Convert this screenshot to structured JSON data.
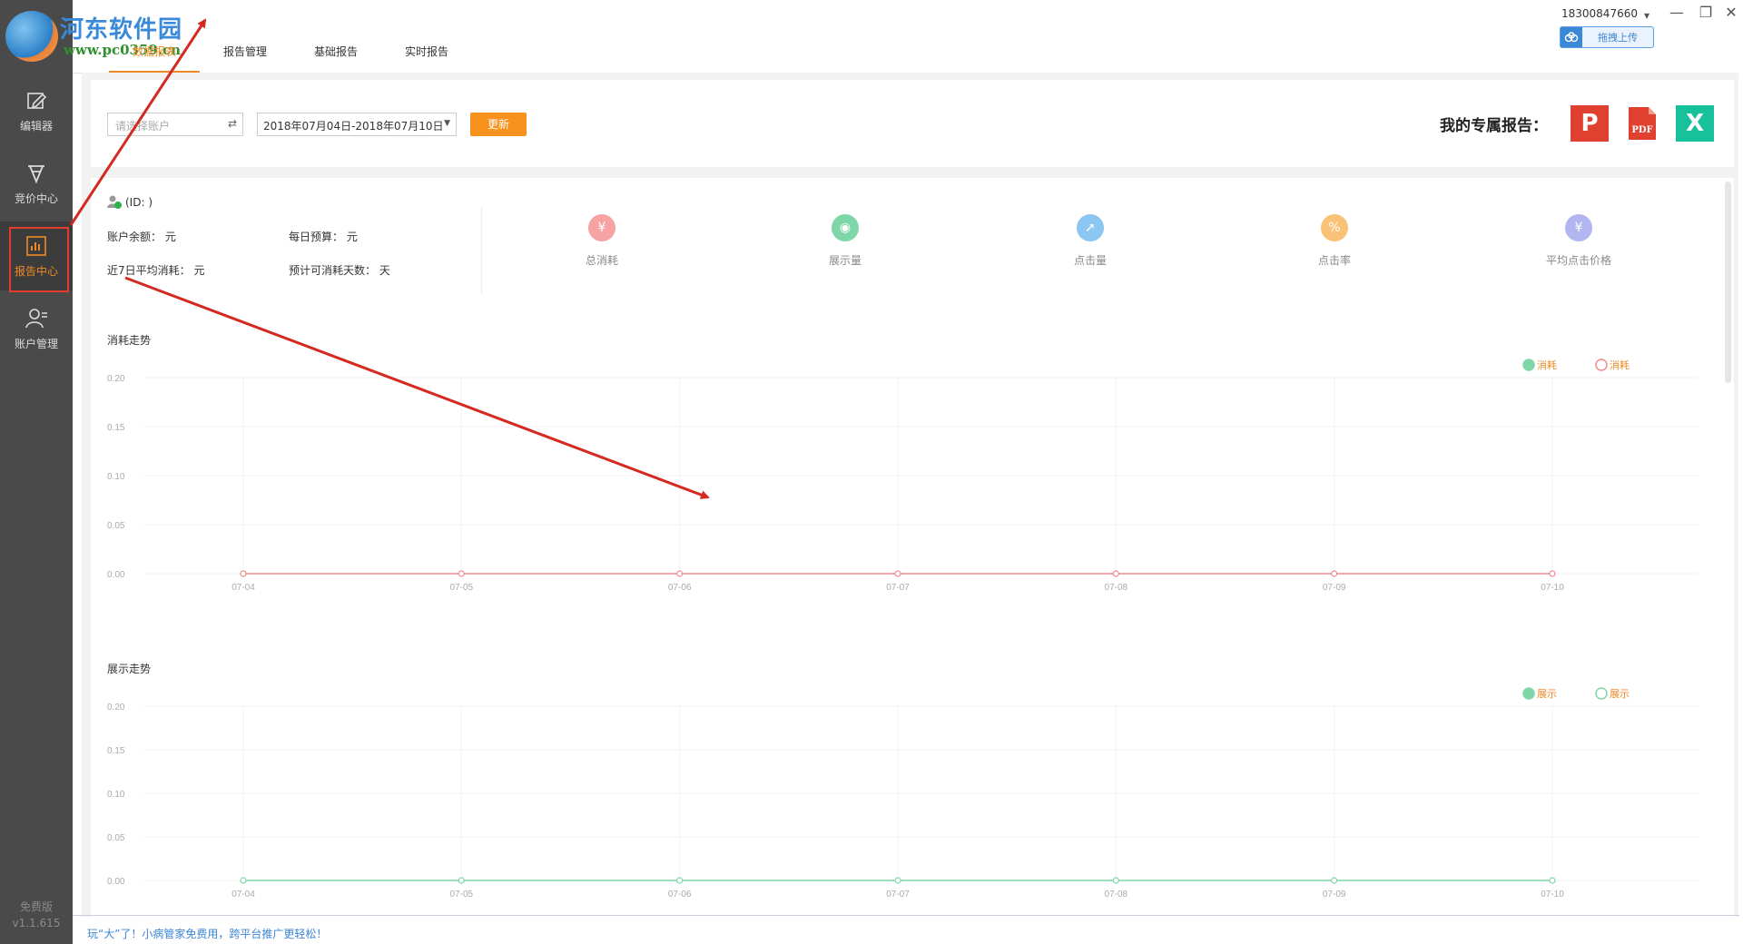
{
  "watermark": {
    "title": "河东软件园",
    "url": "www.pc0359.cn"
  },
  "sidebar": {
    "items": [
      {
        "label": "编辑器",
        "icon": "edit-icon"
      },
      {
        "label": "竞价中心",
        "icon": "bid-icon"
      },
      {
        "label": "报告中心",
        "icon": "report-chart-icon"
      },
      {
        "label": "账户管理",
        "icon": "user-manage-icon"
      }
    ],
    "active_index": 2,
    "edition": "免费版",
    "version": "v1.1.615"
  },
  "tabs": [
    {
      "label": "数据报表"
    },
    {
      "label": "报告管理"
    },
    {
      "label": "基础报告"
    },
    {
      "label": "实时报告"
    }
  ],
  "window": {
    "phone": "18300847660",
    "upload_label": "拖拽上传",
    "controls": [
      "▾",
      "—",
      "❐",
      "✕"
    ]
  },
  "toolbar": {
    "account_placeholder": "请选择账户",
    "date_range": "2018年07月04日-2018年07月10日",
    "refresh_label": "更新",
    "my_report_label": "我的专属报告：",
    "exports": [
      {
        "label": "P",
        "icon": "ppt-icon",
        "color": "#e0402f"
      },
      {
        "label": "PDF",
        "icon": "pdf-icon",
        "color": "#e0402f"
      },
      {
        "label": "X",
        "icon": "excel-icon",
        "color": "#16c19b"
      }
    ]
  },
  "account_info": {
    "id_label": "(ID: )",
    "balance": "账户余额： 元",
    "daily_budget": "每日预算： 元",
    "avg7": "近7日平均消耗： 元",
    "days_left": "预计可消耗天数： 天"
  },
  "metrics": [
    {
      "label": "总消耗",
      "glyph": "¥",
      "icon": "yen-icon",
      "color": "#f7a3a3"
    },
    {
      "label": "展示量",
      "glyph": "◉",
      "icon": "eye-icon",
      "color": "#7fd6a8"
    },
    {
      "label": "点击量",
      "glyph": "➚",
      "icon": "click-icon",
      "color": "#8cc6f2"
    },
    {
      "label": "点击率",
      "glyph": "%",
      "icon": "percent-icon",
      "color": "#f8c277"
    },
    {
      "label": "平均点击价格",
      "glyph": "¥",
      "icon": "avg-price-icon",
      "color": "#b2b6f0"
    }
  ],
  "chart_data": [
    {
      "type": "line",
      "title": "消耗走势",
      "categories": [
        "07-04",
        "07-05",
        "07-06",
        "07-07",
        "07-08",
        "07-09",
        "07-10"
      ],
      "series": [
        {
          "name": "消耗",
          "values": [
            0,
            0,
            0,
            0,
            0,
            0,
            0
          ],
          "color": "#f28b8b"
        }
      ],
      "legend": [
        {
          "name": "消耗",
          "color": "#7fd6a8",
          "filled": true
        },
        {
          "name": "消耗",
          "color": "#f28b8b",
          "filled": false
        }
      ],
      "legend_position": "top-right",
      "ylim": [
        0,
        0.2
      ],
      "yticks": [
        "0.20",
        "0.15",
        "0.10",
        "0.05",
        "0.00"
      ],
      "grid": true
    },
    {
      "type": "line",
      "title": "展示走势",
      "categories": [
        "07-04",
        "07-05",
        "07-06",
        "07-07",
        "07-08",
        "07-09",
        "07-10"
      ],
      "series": [
        {
          "name": "展示",
          "values": [
            0,
            0,
            0,
            0,
            0,
            0,
            0
          ],
          "color": "#7fd6a8"
        }
      ],
      "legend": [
        {
          "name": "展示",
          "color": "#7fd6a8",
          "filled": true
        },
        {
          "name": "展示",
          "color": "#7fd6a8",
          "filled": false
        }
      ],
      "legend_position": "top-right",
      "ylim": [
        0,
        0.2
      ],
      "yticks": [
        "0.20",
        "0.15",
        "0.10",
        "0.05",
        "0.00"
      ],
      "grid": true
    }
  ],
  "footer": {
    "slogan": "玩“大”了！小病管家免费用，跨平台推广更轻松！"
  }
}
